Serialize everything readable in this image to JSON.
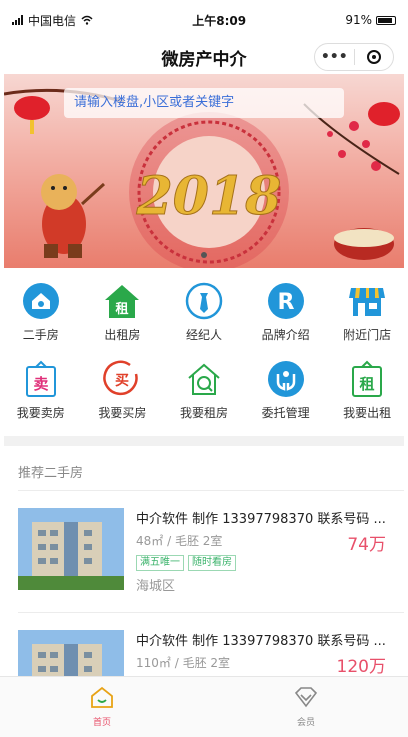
{
  "status_bar": {
    "carrier": "中国电信",
    "time": "上午8:09",
    "battery": "91%"
  },
  "navbar": {
    "title": "微房产中介",
    "menu_label": "•••"
  },
  "banner": {
    "search_placeholder": "请输入楼盘,小区或者关键字",
    "slide_count": 1,
    "banner_text": "2018"
  },
  "grid": {
    "row1": [
      {
        "label": "二手房",
        "icon": "house-icon"
      },
      {
        "label": "出租房",
        "icon": "rent-house-icon"
      },
      {
        "label": "经纪人",
        "icon": "agent-icon"
      },
      {
        "label": "品牌介绍",
        "icon": "brand-icon"
      },
      {
        "label": "附近门店",
        "icon": "store-icon"
      }
    ],
    "row2": [
      {
        "label": "我要卖房",
        "icon": "sell-icon"
      },
      {
        "label": "我要买房",
        "icon": "buy-icon"
      },
      {
        "label": "我要租房",
        "icon": "rent-search-icon"
      },
      {
        "label": "委托管理",
        "icon": "entrust-icon"
      },
      {
        "label": "我要出租",
        "icon": "lease-icon"
      }
    ]
  },
  "section": {
    "title": "推荐二手房"
  },
  "listings": [
    {
      "title": "中介软件 制作 13397798370 联系号码 ...",
      "meta": "48㎡ / 毛胚 2室",
      "price": "74万",
      "tags": [
        "满五唯一",
        "随时看房"
      ],
      "district": "海城区"
    },
    {
      "title": "中介软件 制作 13397798370 联系号码 ...",
      "meta": "110㎡ / 毛胚 2室",
      "price": "120万"
    }
  ],
  "tabbar": {
    "home": "首页",
    "member": "会员"
  },
  "colors": {
    "accent_red": "#e8506a",
    "icon_blue": "#2196d9",
    "icon_green": "#2aa84a",
    "active_tab": "#e8a316"
  }
}
